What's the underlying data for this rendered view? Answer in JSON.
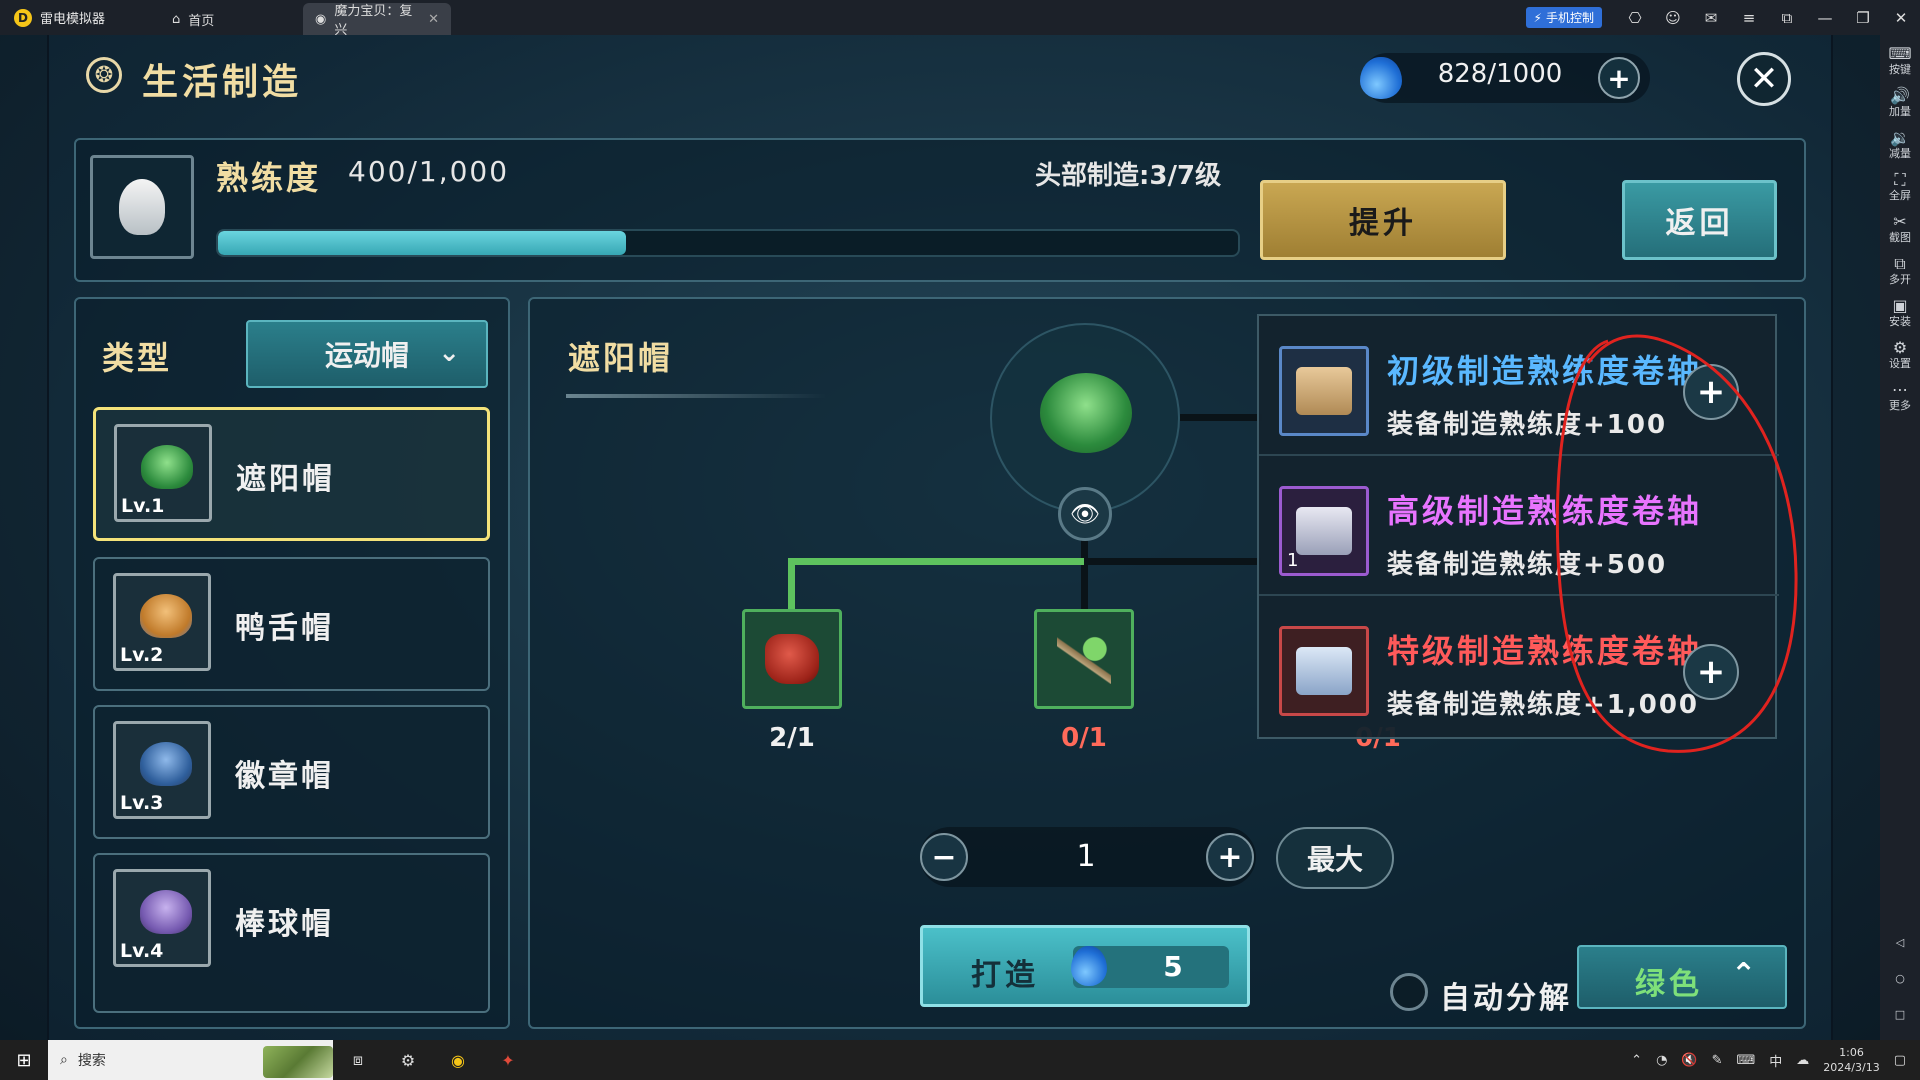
{
  "window": {
    "app_name": "雷电模拟器",
    "tabs": [
      {
        "label": "首页",
        "icon": "home-icon"
      },
      {
        "label": "魔力宝贝：复兴",
        "icon": "game-icon"
      }
    ],
    "phone_control_label": "手机控制"
  },
  "sidebar": {
    "items": [
      {
        "label": "按键",
        "icon": "keyboard-icon"
      },
      {
        "label": "加量",
        "icon": "volume-up-icon"
      },
      {
        "label": "减量",
        "icon": "volume-down-icon"
      },
      {
        "label": "全屏",
        "icon": "fullscreen-icon"
      },
      {
        "label": "截图",
        "icon": "scissors-icon"
      },
      {
        "label": "多开",
        "icon": "multi-instance-icon"
      },
      {
        "label": "安装",
        "icon": "apk-icon"
      },
      {
        "label": "设置",
        "icon": "gear-icon"
      },
      {
        "label": "更多",
        "icon": "more-icon"
      }
    ]
  },
  "game": {
    "title": "生活制造",
    "energy": "828/1000",
    "proficiency": {
      "label": "熟练度",
      "value": "400/1,000",
      "progress": 0.4,
      "head_level": "头部制造:3/7级"
    },
    "upgrade_label": "提升",
    "back_label": "返回",
    "type_label": "类型",
    "type_selected": "运动帽",
    "hats": [
      {
        "name": "遮阳帽",
        "level": "Lv.1",
        "color": "#3cae4a"
      },
      {
        "name": "鸭舌帽",
        "level": "Lv.2",
        "color": "#d79a45"
      },
      {
        "name": "徽章帽",
        "level": "Lv.3",
        "color": "#3a6fb0"
      },
      {
        "name": "棒球帽",
        "level": "Lv.4",
        "color": "#8a6cc0"
      }
    ],
    "recipe": {
      "title": "遮阳帽",
      "materials": [
        {
          "count": "2/1",
          "count_color": "#f0f0f0",
          "name": "red-ore"
        },
        {
          "count": "0/1",
          "count_color": "#ff6a5a",
          "name": "branch"
        },
        {
          "count": "0/1",
          "count_color": "#ff6a5a",
          "name": "hidden-material"
        }
      ]
    },
    "quantity": "1",
    "max_label": "最大",
    "craft_label": "打造",
    "craft_cost": "5",
    "auto_decompose_label": "自动分解",
    "color_filter_label": "绿色"
  },
  "popup": {
    "items": [
      {
        "name": "初级制造熟练度卷轴",
        "desc": "装备制造熟练度+100",
        "name_color": "#5ab8ff",
        "count": "",
        "has_plus": true
      },
      {
        "name": "高级制造熟练度卷轴",
        "desc": "装备制造熟练度+500",
        "name_color": "#e874ff",
        "count": "1",
        "has_plus": false
      },
      {
        "name": "特级制造熟练度卷轴",
        "desc": "装备制造熟练度+1,000",
        "name_color": "#ff5a5a",
        "count": "",
        "has_plus": true
      }
    ]
  },
  "taskbar": {
    "search_placeholder": "搜索",
    "time": "1:06",
    "date": "2024/3/13"
  }
}
